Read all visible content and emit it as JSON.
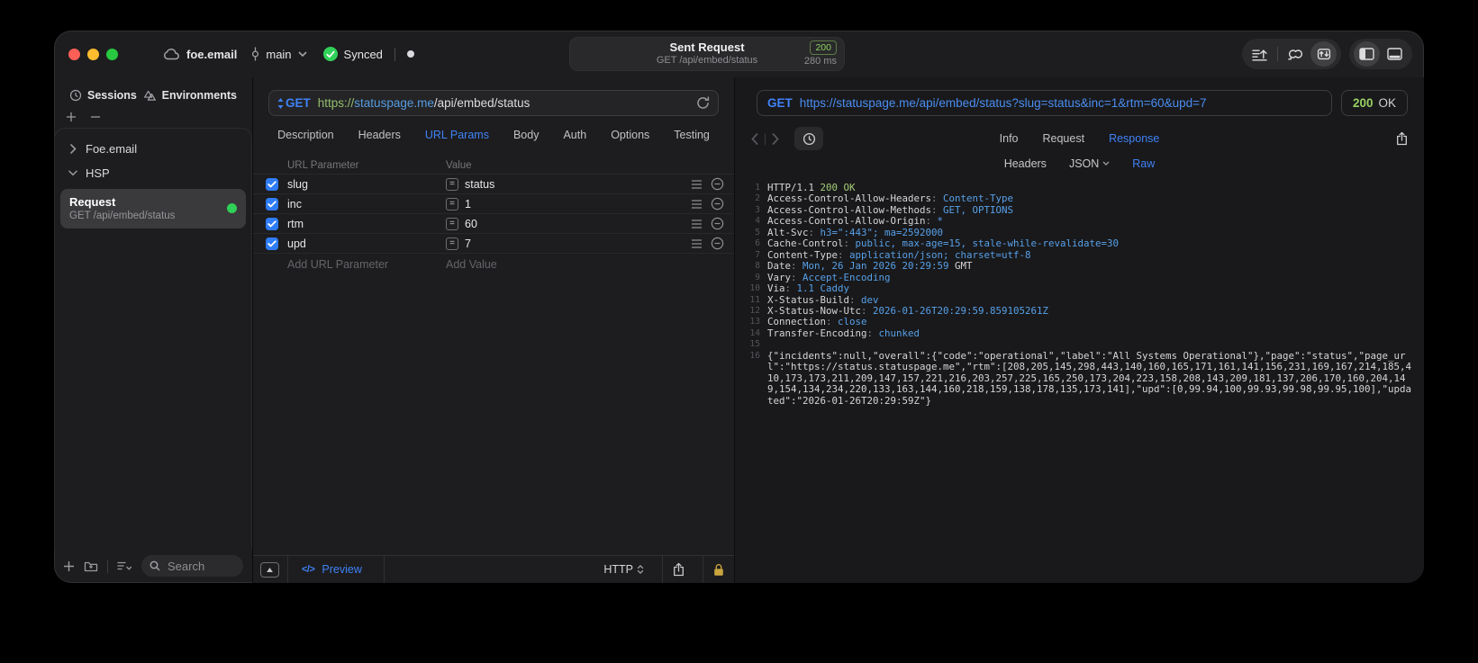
{
  "accent": {
    "blue": "#3f82f7",
    "green_dot": "#30d158",
    "code_blue": "#57a0e8",
    "code_green": "#a5cd79",
    "checkbox_blue": "#2f7cf6",
    "lock_gold": "#caa53e"
  },
  "titlebar": {
    "project": "foe.email",
    "branch": "main",
    "sync": "Synced",
    "center": {
      "title": "Sent Request",
      "subtitle": "GET /api/embed/status",
      "status": "200",
      "time": "280 ms"
    }
  },
  "sidebar": {
    "tabs": [
      "Sessions",
      "Environments"
    ],
    "tree": [
      {
        "label": "Foe.email",
        "expanded": false
      },
      {
        "label": "HSP",
        "expanded": true
      }
    ],
    "request": {
      "title": "Request",
      "subtitle": "GET /api/embed/status"
    },
    "search_placeholder": "Search"
  },
  "request_panel": {
    "method": "GET",
    "url_scheme": "https://",
    "url_host": "statuspage.me",
    "url_path": "/api/embed/status",
    "tabs": [
      "Description",
      "Headers",
      "URL Params",
      "Body",
      "Auth",
      "Options",
      "Testing"
    ],
    "active_tab": "URL Params",
    "table": {
      "col_param": "URL Parameter",
      "col_value": "Value",
      "rows": [
        {
          "name": "slug",
          "value": "status",
          "enabled": true
        },
        {
          "name": "inc",
          "value": "1",
          "enabled": true
        },
        {
          "name": "rtm",
          "value": "60",
          "enabled": true
        },
        {
          "name": "upd",
          "value": "7",
          "enabled": true
        }
      ],
      "add_param": "Add URL Parameter",
      "add_value": "Add Value"
    },
    "footer": {
      "preview": "Preview",
      "code_glyph": "</>",
      "http": "HTTP"
    }
  },
  "response_panel": {
    "method": "GET",
    "url": "https://statuspage.me/api/embed/status?slug=status&inc=1&rtm=60&upd=7",
    "status_code": "200",
    "status_text": "OK",
    "tabs": [
      "Info",
      "Request",
      "Response"
    ],
    "active_tab": "Response",
    "subtabs": [
      "Headers",
      "JSON",
      "Raw"
    ],
    "active_subtab": "Raw",
    "code_lines": [
      {
        "n": "1",
        "seg": [
          [
            "p",
            "HTTP/1.1 "
          ],
          [
            "g",
            "200 OK"
          ]
        ]
      },
      {
        "n": "2",
        "seg": [
          [
            "p",
            "Access-Control-Allow-Headers"
          ],
          [
            "d",
            ": "
          ],
          [
            "b",
            "Content-Type"
          ]
        ]
      },
      {
        "n": "3",
        "seg": [
          [
            "p",
            "Access-Control-Allow-Methods"
          ],
          [
            "d",
            ": "
          ],
          [
            "b",
            "GET, OPTIONS"
          ]
        ]
      },
      {
        "n": "4",
        "seg": [
          [
            "p",
            "Access-Control-Allow-Origin"
          ],
          [
            "d",
            ": "
          ],
          [
            "b",
            "*"
          ]
        ]
      },
      {
        "n": "5",
        "seg": [
          [
            "p",
            "Alt-Svc"
          ],
          [
            "d",
            ": "
          ],
          [
            "b",
            "h3=\":443\"; ma=2592000"
          ]
        ]
      },
      {
        "n": "6",
        "seg": [
          [
            "p",
            "Cache-Control"
          ],
          [
            "d",
            ": "
          ],
          [
            "b",
            "public, max-age=15, stale-while-revalidate=30"
          ]
        ]
      },
      {
        "n": "7",
        "seg": [
          [
            "p",
            "Content-Type"
          ],
          [
            "d",
            ": "
          ],
          [
            "b",
            "application/json; charset=utf-8"
          ]
        ]
      },
      {
        "n": "8",
        "seg": [
          [
            "p",
            "Date"
          ],
          [
            "d",
            ": "
          ],
          [
            "b",
            "Mon, 26 Jan 2026 20:29:59 "
          ],
          [
            "p",
            "GMT"
          ]
        ]
      },
      {
        "n": "9",
        "seg": [
          [
            "p",
            "Vary"
          ],
          [
            "d",
            ": "
          ],
          [
            "b",
            "Accept-Encoding"
          ]
        ]
      },
      {
        "n": "10",
        "seg": [
          [
            "p",
            "Via"
          ],
          [
            "d",
            ": "
          ],
          [
            "b",
            "1.1 Caddy"
          ]
        ]
      },
      {
        "n": "11",
        "seg": [
          [
            "p",
            "X-Status-Build"
          ],
          [
            "d",
            ": "
          ],
          [
            "b",
            "dev"
          ]
        ]
      },
      {
        "n": "12",
        "seg": [
          [
            "p",
            "X-Status-Now-Utc"
          ],
          [
            "d",
            ": "
          ],
          [
            "b",
            "2026-01-26T20:29:59.859105261Z"
          ]
        ]
      },
      {
        "n": "13",
        "seg": [
          [
            "p",
            "Connection"
          ],
          [
            "d",
            ": "
          ],
          [
            "b",
            "close"
          ]
        ]
      },
      {
        "n": "14",
        "seg": [
          [
            "p",
            "Transfer-Encoding"
          ],
          [
            "d",
            ": "
          ],
          [
            "b",
            "chunked"
          ]
        ]
      },
      {
        "n": "15",
        "seg": []
      },
      {
        "n": "16",
        "seg": [
          [
            "p",
            "{\"incidents\":null,\"overall\":{\"code\":\"operational\",\"label\":\"All Systems Operational\"},\"page\":\"status\",\"page_url\":\"https://status.statuspage.me\",\"rtm\":[208,205,145,298,443,140,160,165,171,161,141,156,231,169,167,214,185,410,173,173,211,209,147,157,221,216,203,257,225,165,250,173,204,223,158,208,143,209,181,137,206,170,160,204,149,154,134,234,220,133,163,144,160,218,159,138,178,135,173,141],\"upd\":[0,99.94,100,99.93,99.98,99.95,100],\"updated\":\"2026-01-26T20:29:59Z\"}"
          ]
        ]
      }
    ]
  }
}
